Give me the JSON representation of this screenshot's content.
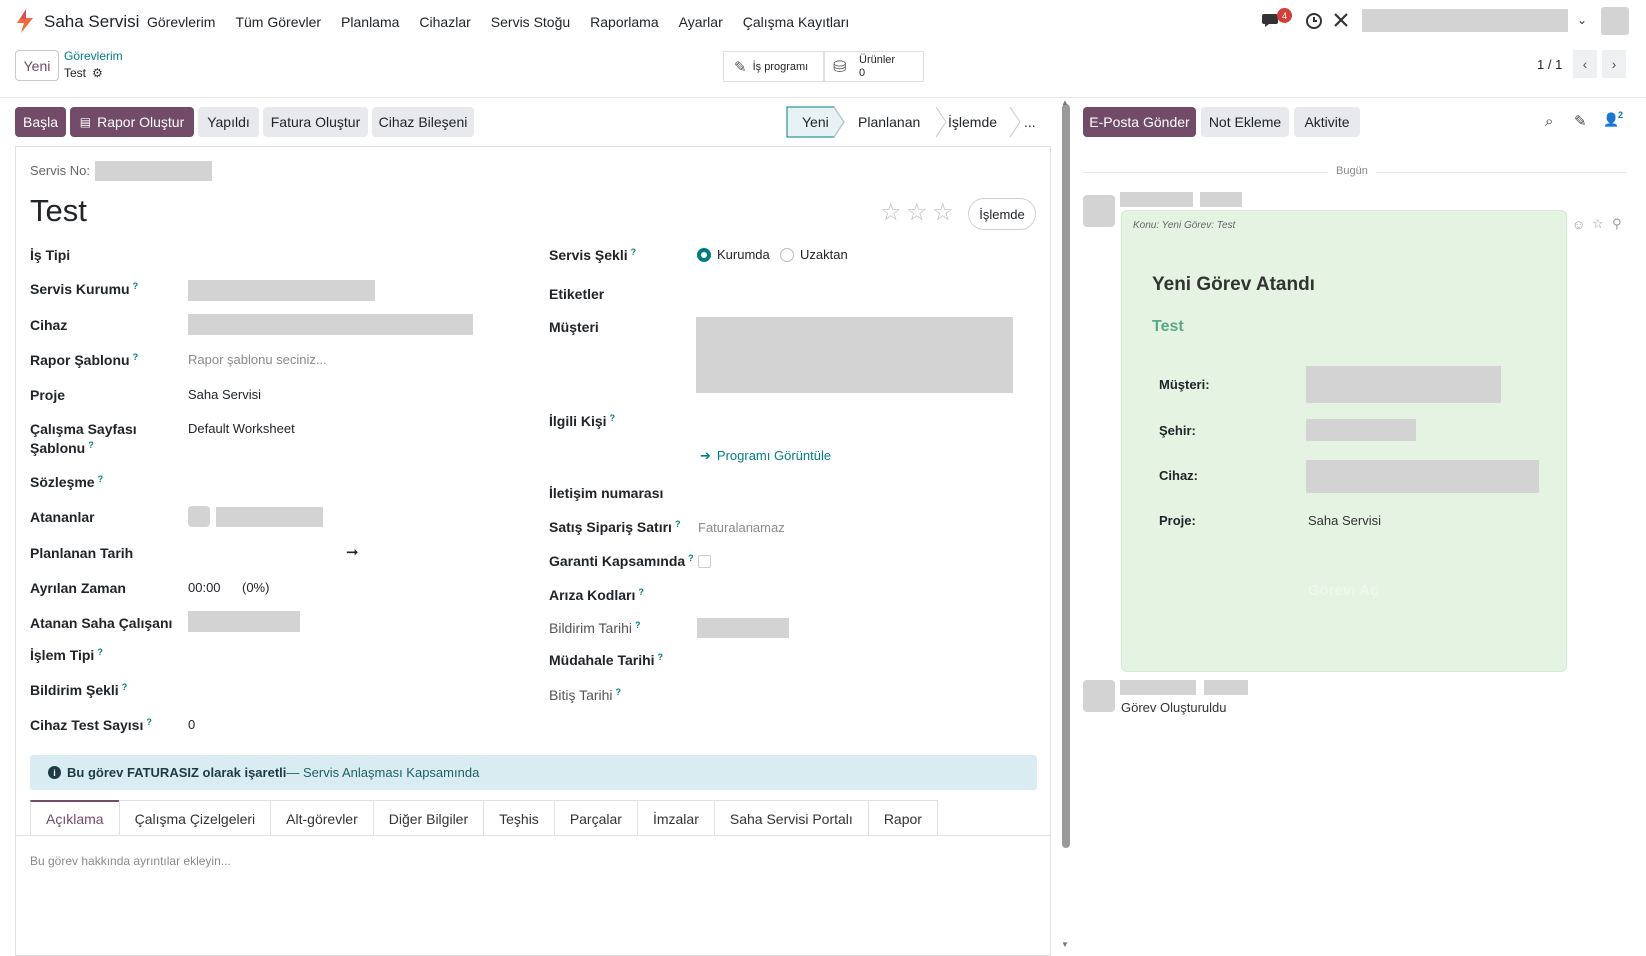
{
  "app": {
    "name": "Saha Servisi",
    "menu": [
      "Görevlerim",
      "Tüm Görevler",
      "Planlama",
      "Cihazlar",
      "Servis Stoğu",
      "Raporlama",
      "Ayarlar",
      "Çalışma Kayıtları"
    ],
    "notif_count": "4"
  },
  "subbar": {
    "new_label": "Yeni",
    "breadcrumb_parent": "Görevlerim",
    "breadcrumb_current": "Test",
    "smart_worksheet": "İş programı",
    "smart_products_label": "Ürünler",
    "smart_products_count": "0",
    "pager": "1 / 1"
  },
  "actions": {
    "start": "Başla",
    "report": "Rapor Oluştur",
    "done": "Yapıldı",
    "invoice": "Fatura Oluştur",
    "component": "Cihaz Bileşeni"
  },
  "stages": {
    "s1": "Yeni",
    "s2": "Planlanan",
    "s3": "İşlemde",
    "more": "..."
  },
  "chatter_actions": {
    "send": "E-Posta Gönder",
    "note": "Not Ekleme",
    "activity": "Aktivite",
    "followers": "2"
  },
  "form": {
    "service_no_label": "Servis No:",
    "title": "Test",
    "status_badge": "İşlemde",
    "left": {
      "job_type": "İş Tipi",
      "service_org": "Servis Kurumu",
      "device": "Cihaz",
      "report_template": "Rapor Şablonu",
      "report_template_ph": "Rapor şablonu seciniz...",
      "project": "Proje",
      "project_val": "Saha Servisi",
      "worksheet_l1": "Çalışma Sayfası",
      "worksheet_l2": "Şablonu",
      "worksheet_val": "Default Worksheet",
      "contract": "Sözleşme",
      "assignees": "Atananlar",
      "planned_date": "Planlanan Tarih",
      "allocated": "Ayrılan Zaman",
      "allocated_val": "00:00",
      "allocated_pct": "(0%)",
      "field_worker": "Atanan Saha Çalışanı",
      "operation_type": "İşlem Tipi",
      "notif_type": "Bildirim Şekli",
      "test_count": "Cihaz Test Sayısı",
      "test_count_val": "0"
    },
    "right": {
      "service_mode": "Servis Şekli",
      "opt_onsite": "Kurumda",
      "opt_remote": "Uzaktan",
      "tags": "Etiketler",
      "customer": "Müşteri",
      "contact": "İlgili Kişi",
      "program_link": "Programı Görüntüle",
      "phone": "İletişim numarası",
      "sale_line": "Satış Sipariş Satırı",
      "sale_line_ph": "Faturalanamaz",
      "warranty": "Garanti Kapsamında",
      "fault_codes": "Arıza Kodları",
      "notif_date": "Bildirim Tarihi",
      "intervention_date": "Müdahale Tarihi",
      "end_date": "Bitiş Tarihi"
    },
    "alert_bold": "Bu görev FATURASIZ olarak işaretli",
    "alert_rest": " — Servis Anlaşması Kapsamında",
    "tabs": [
      "Açıklama",
      "Çalışma Çizelgeleri",
      "Alt-görevler",
      "Diğer Bilgiler",
      "Teşhis",
      "Parçalar",
      "İmzalar",
      "Saha Servisi Portalı",
      "Rapor"
    ],
    "description_ph": "Bu görev hakkında ayrıntılar ekleyin..."
  },
  "chatter": {
    "today": "Bugün",
    "subject": "Konu: Yeni Görev: Test",
    "mail_title": "Yeni Görev Atandı",
    "mail_task": "Test",
    "mail_customer": "Müşteri:",
    "mail_city": "Şehir:",
    "mail_device": "Cihaz:",
    "mail_project": "Proje:",
    "mail_project_val": "Saha Servisi",
    "mail_button": "Görevi Aç",
    "created": "Görev Oluşturuldu"
  }
}
